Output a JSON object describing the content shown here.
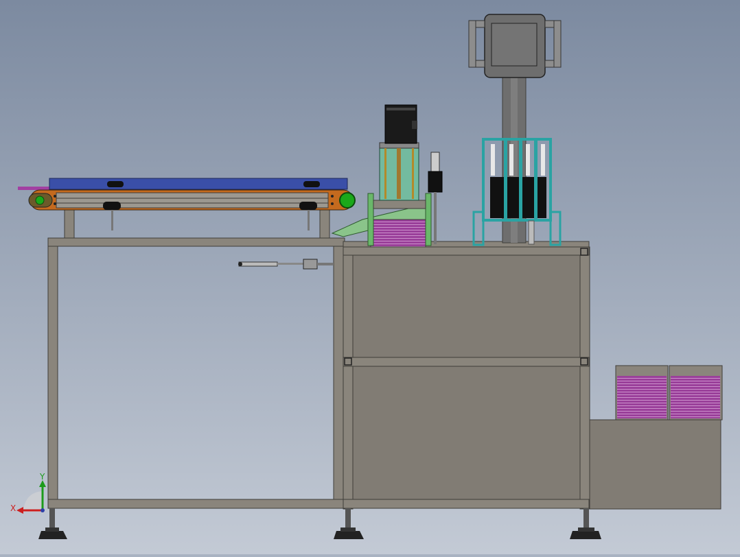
{
  "viewport": {
    "background_top": "#7c8aa0",
    "background_bottom": "#c3cad5"
  },
  "colors": {
    "frame": "#888278",
    "frame_dark": "#4f4c47",
    "panel": "#817c74",
    "belt": "#3a4fa8",
    "roller": "#c46a1e",
    "roller_green": "#1aa81a",
    "motor": "#1a1a1a",
    "acrylic": "#6cc29b",
    "magenta_stack": "#9a3f9a",
    "teal_frame": "#2aa3a3",
    "post": "#6e6e6e",
    "guide_green": "#6ab86a",
    "foot": "#222222"
  },
  "triad": {
    "x_label": "X",
    "y_label": "Y",
    "x_color": "#cc1f1f",
    "y_color": "#1c9b1c",
    "z_color": "#2c3fa8"
  },
  "icons": {
    "triad": "coordinate-triad-icon"
  }
}
